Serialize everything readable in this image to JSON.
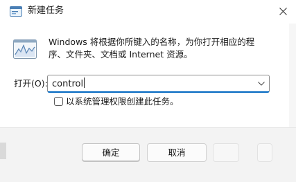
{
  "window": {
    "title": "新建任务",
    "description": "Windows 将根据你所键入的名称，为你打开相应的程序、文件夹、文档或 Internet 资源。"
  },
  "icons": {
    "title_icon": "run-dialog-icon",
    "app_icon": "performance-monitor-icon",
    "close_icon": "close-icon",
    "dropdown_icon": "chevron-down-icon"
  },
  "open_field": {
    "label": "打开(O):",
    "value": "control"
  },
  "admin_option": {
    "label": "以系统管理权限创建此任务。",
    "checked": false
  },
  "buttons": {
    "ok": "确定",
    "cancel": "取消"
  },
  "colors": {
    "accent": "#0067c0",
    "footer": "#f3f3f3"
  }
}
